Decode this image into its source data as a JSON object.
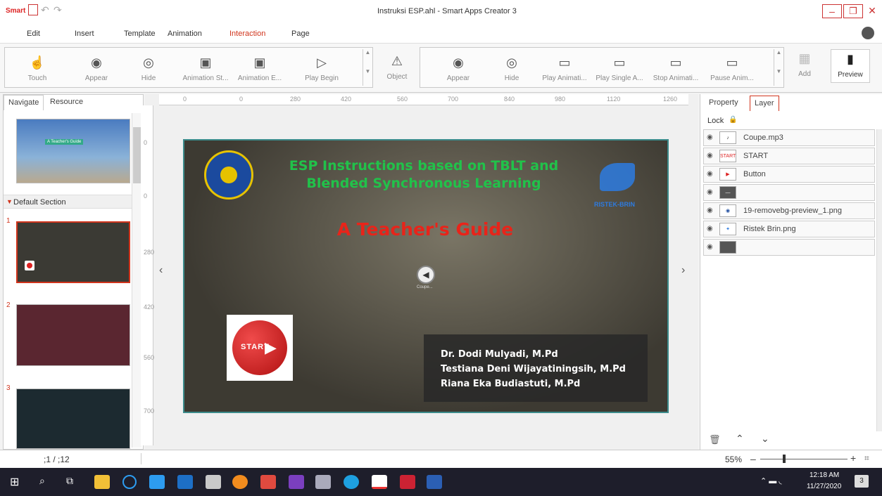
{
  "window": {
    "logo": "Smart",
    "title": "Instruksi ESP.ahl - Smart Apps Creator 3",
    "controls": [
      "–",
      "❐",
      "✕"
    ]
  },
  "menu": [
    "Edit",
    "Insert",
    "Template",
    "Animation",
    "Interaction",
    "Page"
  ],
  "menu_active": "Interaction",
  "toolbar": {
    "left": [
      "Touch",
      "Appear",
      "Hide",
      "Animation St...",
      "Animation E...",
      "Play Begin"
    ],
    "object": "Object",
    "right": [
      "Appear",
      "Hide",
      "Play Animati...",
      "Play Single A...",
      "Stop Animati...",
      "Pause Anim..."
    ],
    "add": "Add",
    "preview": "Preview"
  },
  "left_panel": {
    "tabs": [
      "Navigate",
      "Resource"
    ],
    "section": "Default Section",
    "slide_numbers": [
      "1",
      "2",
      "3"
    ],
    "thumb1_title": "A Teacher's Guide"
  },
  "ruler": {
    "h": [
      "0",
      "0",
      "280",
      "420",
      "560",
      "700",
      "840",
      "980",
      "1120",
      "1260"
    ],
    "v": [
      "0",
      "0",
      "280",
      "420",
      "560",
      "700"
    ]
  },
  "slide": {
    "title_line1": "ESP Instructions based on TBLT and",
    "title_line2": "Blended Synchronous Learning",
    "subtitle": "A Teacher's Guide",
    "start_label": "START",
    "audio_label": "Coupe...",
    "authors": [
      "Dr. Dodi Mulyadi, M.Pd",
      "Testiana Deni Wijayatiningsih, M.Pd",
      "Riana Eka Budiastuti, M.Pd"
    ],
    "logo_right": "RISTEK-BRIN",
    "colors": {
      "title": "#21c24a",
      "subtitle": "#e8241a"
    }
  },
  "right_panel": {
    "tabs": [
      "Property",
      "Layer"
    ],
    "lock": "Lock",
    "layers": [
      {
        "name": "Coupe.mp3",
        "thumb": "♪"
      },
      {
        "name": "START",
        "thumb": "START"
      },
      {
        "name": "Button",
        "thumb": "▶"
      },
      {
        "name": "",
        "thumb": "—"
      },
      {
        "name": "19-removebg-preview_1.png",
        "thumb": "◉"
      },
      {
        "name": "Ristek Brin.png",
        "thumb": "✦"
      },
      {
        "name": "",
        "thumb": ""
      }
    ]
  },
  "status": {
    "page": ";1 / ;12",
    "zoom": "55%"
  },
  "taskbar": {
    "time": "12:18 AM",
    "date": "11/27/2020",
    "notif": "3"
  }
}
